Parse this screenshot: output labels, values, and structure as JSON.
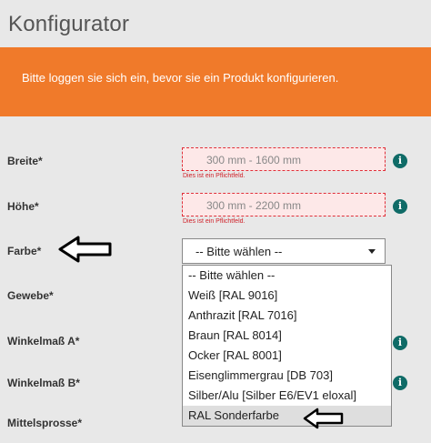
{
  "header": {
    "title": "Konfigurator"
  },
  "banner": {
    "message": "Bitte loggen sie sich ein, bevor sie ein Produkt konfigurieren."
  },
  "fields": {
    "breite": {
      "label": "Breite*",
      "placeholder": "300 mm - 1600 mm",
      "error": "Dies ist ein Pflichtfeld."
    },
    "hoehe": {
      "label": "Höhe*",
      "placeholder": "300 mm - 2200 mm",
      "error": "Dies ist ein Pflichtfeld."
    },
    "farbe": {
      "label": "Farbe*",
      "selected": "-- Bitte wählen --"
    },
    "gewebe": {
      "label": "Gewebe*"
    },
    "winkel_a": {
      "label": "Winkelmaß A*"
    },
    "winkel_b": {
      "label": "Winkelmaß B*"
    },
    "mittelsprosse": {
      "label": "Mittelsprosse*"
    }
  },
  "info_glyph": "i",
  "dropdown": {
    "options": [
      "-- Bitte wählen --",
      "Weiß [RAL 9016]",
      "Anthrazit [RAL 7016]",
      "Braun [RAL 8014]",
      "Ocker [RAL 8001]",
      "Eisenglimmergrau [DB 703]",
      "Silber/Alu [Silber E6/EV1 eloxal]",
      "RAL Sonderfarbe"
    ],
    "highlighted": "RAL Sonderfarbe"
  },
  "colors": {
    "accent": "#f07a2a",
    "info": "#0f6b67",
    "error": "#e0303a"
  }
}
